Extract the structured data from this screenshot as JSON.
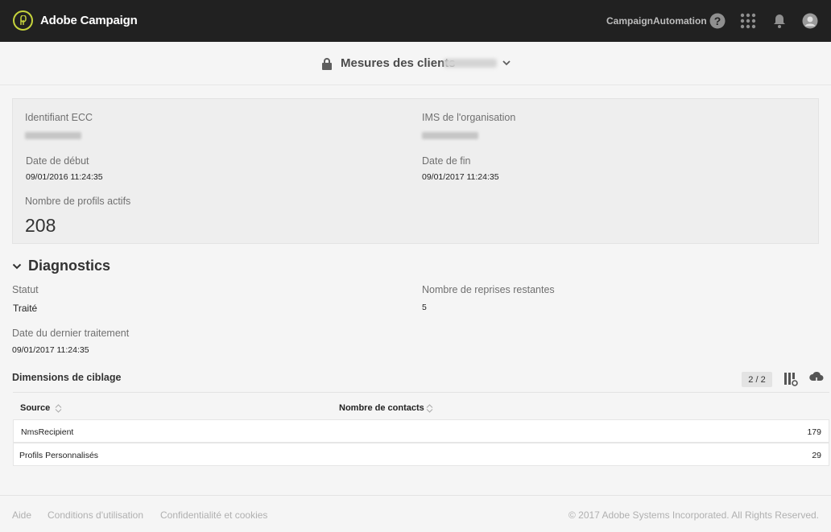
{
  "topbar": {
    "app_title": "Adobe Campaign",
    "instance": "CampaignAutomation",
    "icons": [
      "help-icon",
      "apps-grid-icon",
      "bell-icon",
      "avatar-icon"
    ]
  },
  "header": {
    "title": "Mesures des clients"
  },
  "info": {
    "ecc_label": "Identifiant ECC",
    "ims_label": "IMS de l'organisation",
    "start_label": "Date de début",
    "start_value": "09/01/2016 11:24:35",
    "end_label": "Date de fin",
    "end_value": "09/01/2017 11:24:35",
    "profiles_label": "Nombre de profils actifs",
    "profiles_value": "208"
  },
  "diagnostics": {
    "title": "Diagnostics",
    "status_label": "Statut",
    "status_value": "Traité",
    "retries_label": "Nombre de reprises restantes",
    "retries_value": "5",
    "last_label": "Date du dernier traitement",
    "last_value": "09/01/2017 11:24:35"
  },
  "targeting": {
    "title": "Dimensions de ciblage",
    "pager": "2 / 2",
    "columns": [
      "Source",
      "Nombre de contacts"
    ],
    "rows": [
      {
        "source": "NmsRecipient",
        "count": "179"
      },
      {
        "source": "Profils Personnalisés",
        "count": "29"
      }
    ]
  },
  "footer": {
    "links": [
      "Aide",
      "Conditions d'utilisation",
      "Confidentialité et cookies"
    ],
    "copyright": "© 2017 Adobe Systems Incorporated. All Rights Reserved."
  },
  "colors": {
    "topbar_bg": "#212121",
    "logo_accent": "#c5d33c",
    "page_bg": "#f5f5f5"
  }
}
